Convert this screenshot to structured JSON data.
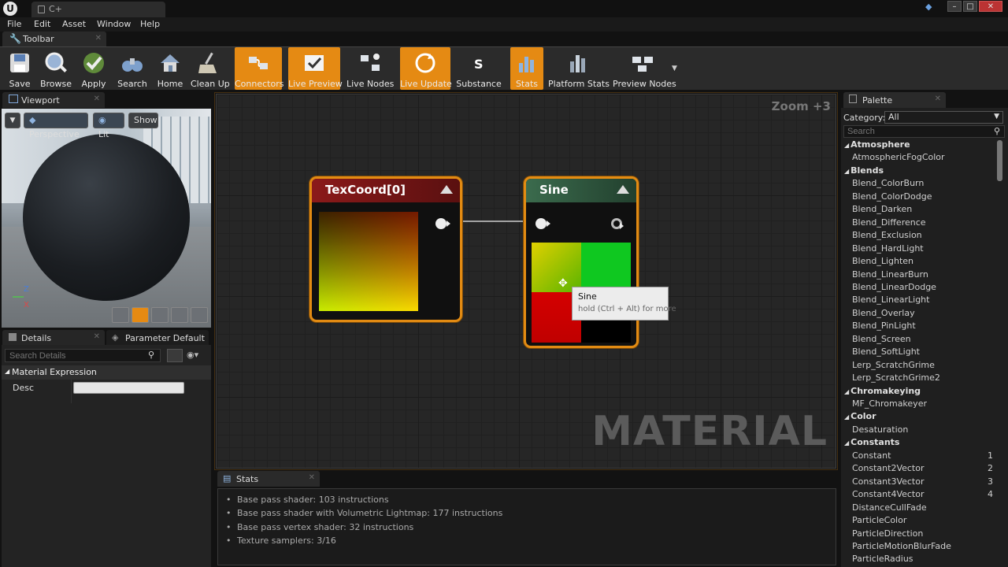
{
  "window": {
    "tab_title": "C+",
    "app_logo": "U"
  },
  "menu": [
    "File",
    "Edit",
    "Asset",
    "Window",
    "Help"
  ],
  "toolbar": {
    "tab_label": "Toolbar",
    "buttons": [
      {
        "label": "Save",
        "icon": "save-icon",
        "active": false
      },
      {
        "label": "Browse",
        "icon": "browse-icon",
        "active": false
      },
      {
        "label": "Apply",
        "icon": "apply-icon",
        "active": false
      },
      {
        "label": "Search",
        "icon": "search-icon",
        "active": false
      },
      {
        "label": "Home",
        "icon": "home-icon",
        "active": false
      },
      {
        "label": "Clean Up",
        "icon": "cleanup-icon",
        "active": false
      },
      {
        "label": "Connectors",
        "icon": "connectors-icon",
        "active": true
      },
      {
        "label": "Live Preview",
        "icon": "live-preview-icon",
        "active": true
      },
      {
        "label": "Live Nodes",
        "icon": "live-nodes-icon",
        "active": false
      },
      {
        "label": "Live Update",
        "icon": "live-update-icon",
        "active": true
      },
      {
        "label": "Substance",
        "icon": "substance-icon",
        "active": false
      },
      {
        "label": "Stats",
        "icon": "stats-icon",
        "active": true
      },
      {
        "label": "Platform Stats",
        "icon": "platform-stats-icon",
        "active": false
      },
      {
        "label": "Preview Nodes",
        "icon": "preview-nodes-icon",
        "active": false
      }
    ]
  },
  "viewport": {
    "tab_label": "Viewport",
    "perspective": "Perspective",
    "lit": "Lit",
    "show": "Show",
    "axis_z": "Z",
    "axis_x": "X"
  },
  "details": {
    "tab_label": "Details",
    "tab2_label": "Parameter Default",
    "search_placeholder": "Search Details",
    "section": "Material Expression",
    "desc_label": "Desc",
    "desc_value": ""
  },
  "graph": {
    "zoom": "Zoom +3",
    "watermark": "MATERIAL",
    "node1_title": "TexCoord[0]",
    "node2_title": "Sine",
    "tooltip_title": "Sine",
    "tooltip_hint": "hold (Ctrl + Alt) for more"
  },
  "stats": {
    "tab_label": "Stats",
    "lines": [
      "Base pass shader: 103 instructions",
      "Base pass shader with Volumetric Lightmap: 177 instructions",
      "Base pass vertex shader: 32 instructions",
      "Texture samplers: 3/16"
    ]
  },
  "palette": {
    "tab_label": "Palette",
    "category_label": "Category:",
    "category_value": "All",
    "search_placeholder": "Search",
    "rows": [
      {
        "type": "cat",
        "text": "Atmosphere"
      },
      {
        "type": "item",
        "text": "AtmosphericFogColor"
      },
      {
        "type": "cat",
        "text": "Blends"
      },
      {
        "type": "item",
        "text": "Blend_ColorBurn"
      },
      {
        "type": "item",
        "text": "Blend_ColorDodge"
      },
      {
        "type": "item",
        "text": "Blend_Darken"
      },
      {
        "type": "item",
        "text": "Blend_Difference"
      },
      {
        "type": "item",
        "text": "Blend_Exclusion"
      },
      {
        "type": "item",
        "text": "Blend_HardLight"
      },
      {
        "type": "item",
        "text": "Blend_Lighten"
      },
      {
        "type": "item",
        "text": "Blend_LinearBurn"
      },
      {
        "type": "item",
        "text": "Blend_LinearDodge"
      },
      {
        "type": "item",
        "text": "Blend_LinearLight"
      },
      {
        "type": "item",
        "text": "Blend_Overlay"
      },
      {
        "type": "item",
        "text": "Blend_PinLight"
      },
      {
        "type": "item",
        "text": "Blend_Screen"
      },
      {
        "type": "item",
        "text": "Blend_SoftLight"
      },
      {
        "type": "item",
        "text": "Lerp_ScratchGrime"
      },
      {
        "type": "item",
        "text": "Lerp_ScratchGrime2"
      },
      {
        "type": "cat",
        "text": "Chromakeying"
      },
      {
        "type": "item",
        "text": "MF_Chromakeyer"
      },
      {
        "type": "cat",
        "text": "Color"
      },
      {
        "type": "item",
        "text": "Desaturation"
      },
      {
        "type": "cat",
        "text": "Constants"
      },
      {
        "type": "item",
        "text": "Constant",
        "key": "1"
      },
      {
        "type": "item",
        "text": "Constant2Vector",
        "key": "2"
      },
      {
        "type": "item",
        "text": "Constant3Vector",
        "key": "3"
      },
      {
        "type": "item",
        "text": "Constant4Vector",
        "key": "4"
      },
      {
        "type": "item",
        "text": "DistanceCullFade"
      },
      {
        "type": "item",
        "text": "ParticleColor"
      },
      {
        "type": "item",
        "text": "ParticleDirection"
      },
      {
        "type": "item",
        "text": "ParticleMotionBlurFade"
      },
      {
        "type": "item",
        "text": "ParticleRadius"
      }
    ]
  },
  "colors": {
    "accent": "#e58a13",
    "node_header_texcoord": "#8b1a1a",
    "node_header_sine": "#2f5e42"
  }
}
